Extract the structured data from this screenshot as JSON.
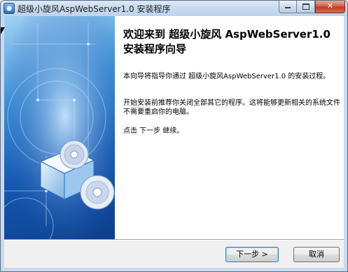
{
  "window": {
    "title": "超级小旋风AspWebServer1.0  安装程序",
    "controls": {
      "minimize_icon": "minimize-icon",
      "maximize_icon": "maximize-icon",
      "close_icon": "close-icon",
      "close_glyph": "✕"
    }
  },
  "wizard": {
    "heading": "欢迎来到 超级小旋风 AspWebServer1.0 安装程序向导",
    "paragraph1": "本向导将指导你通过 超级小旋风AspWebServer1.0 的安装过程。",
    "paragraph2": "开始安装前推荐你关闭全部其它的程序。这将能够更新相关的系统文件不需要重启你的电脑。",
    "paragraph3": "点击 下一步 继续。"
  },
  "buttons": {
    "next_label": "下一步 >",
    "cancel_label": "取消"
  },
  "colors": {
    "banner_dark": "#0d3f8c",
    "banner_light": "#a5d2f4",
    "close_red": "#c23a1e"
  }
}
